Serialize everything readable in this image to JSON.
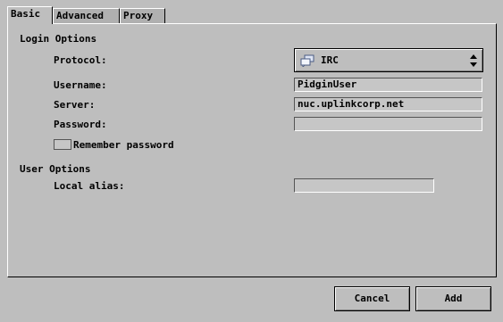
{
  "tabs": [
    {
      "label": "Basic",
      "active": true
    },
    {
      "label": "Advanced",
      "active": false
    },
    {
      "label": "Proxy",
      "active": false
    }
  ],
  "login_options": {
    "section_title": "Login Options",
    "protocol_label": "Protocol:",
    "protocol_value": "IRC",
    "username_label": "Username:",
    "username_value": "PidginUser",
    "server_label": "Server:",
    "server_value": "nuc.uplinkcorp.net",
    "password_label": "Password:",
    "password_value": "",
    "remember_label": "Remember password",
    "remember_checked": false
  },
  "user_options": {
    "section_title": "User Options",
    "alias_label": "Local alias:",
    "alias_value": ""
  },
  "buttons": {
    "cancel": "Cancel",
    "add": "Add"
  },
  "icons": {
    "protocol_icon": "chat-bubbles-icon",
    "combo_arrow": "updown-arrows-icon"
  }
}
